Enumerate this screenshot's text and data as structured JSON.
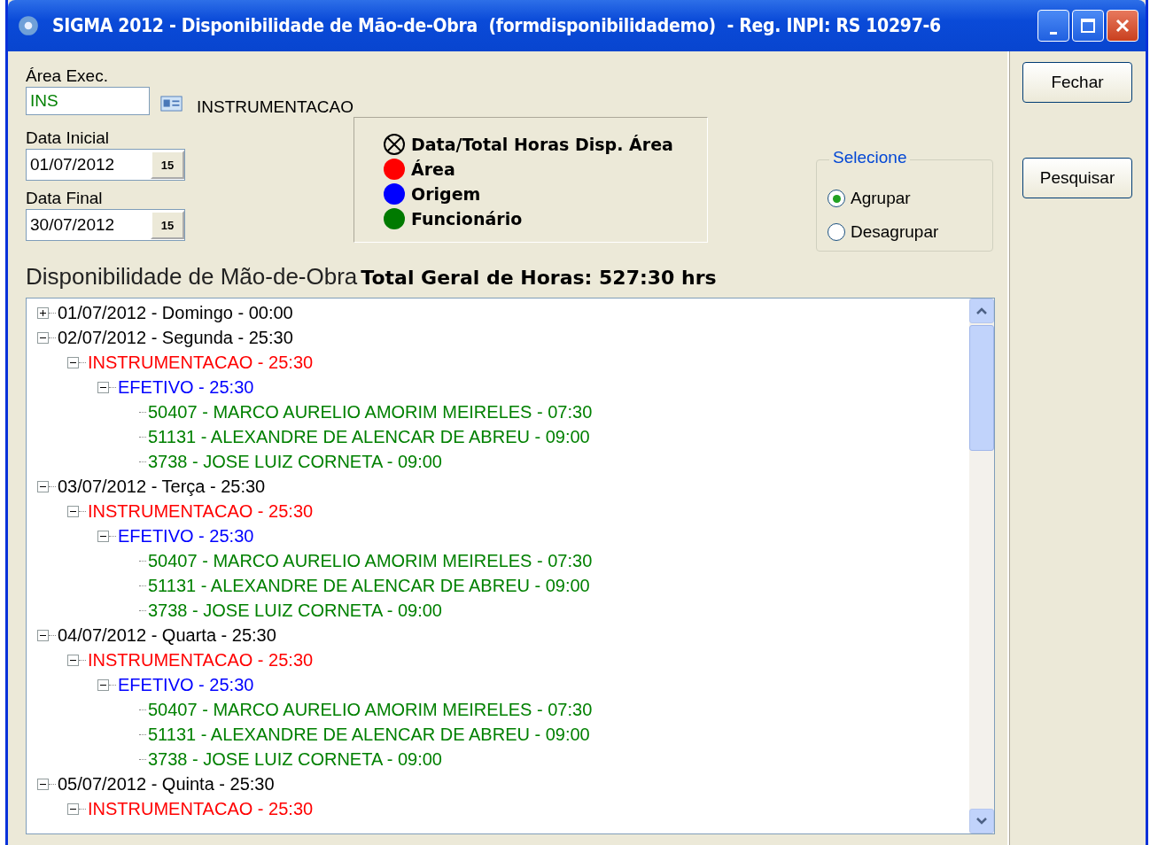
{
  "window": {
    "title": "SIGMA 2012 - Disponibilidade de Mão-de-Obra  (formdisponibilidademo)  - Reg. INPI: RS 10297-6"
  },
  "area_exec": {
    "label": "Área Exec.",
    "value": "INS",
    "description": "INSTRUMENTACAO"
  },
  "data_inicial": {
    "label": "Data Inicial",
    "value": "01/07/2012",
    "button": "15"
  },
  "data_final": {
    "label": "Data Final",
    "value": "30/07/2012",
    "button": "15"
  },
  "legend": [
    {
      "kind": "cross",
      "label": "Data/Total Horas Disp. Área"
    },
    {
      "kind": "dot",
      "color": "#ff0000",
      "label": "Área"
    },
    {
      "kind": "dot",
      "color": "#0000ff",
      "label": "Origem"
    },
    {
      "kind": "dot",
      "color": "#007a00",
      "label": "Funcionário"
    }
  ],
  "selecione": {
    "title": "Selecione",
    "options": [
      {
        "label": "Agrupar",
        "selected": true
      },
      {
        "label": "Desagrupar",
        "selected": false
      }
    ]
  },
  "section_title": "Disponibilidade de Mão-de-Obra",
  "total": "Total Geral de Horas: 527:30 hrs",
  "tree": [
    {
      "kind": "date",
      "label": "01/07/2012 - Domingo - 00:00",
      "expanded": false
    },
    {
      "kind": "date",
      "label": "02/07/2012 - Segunda - 25:30",
      "expanded": true,
      "children": [
        {
          "kind": "area",
          "label": "INSTRUMENTACAO - 25:30",
          "expanded": true,
          "children": [
            {
              "kind": "origem",
              "label": "EFETIVO - 25:30",
              "expanded": true,
              "children": [
                {
                  "kind": "funcionario",
                  "label": "50407 - MARCO AURELIO AMORIM MEIRELES - 07:30"
                },
                {
                  "kind": "funcionario",
                  "label": "51131 - ALEXANDRE DE ALENCAR DE ABREU - 09:00"
                },
                {
                  "kind": "funcionario",
                  "label": "3738 - JOSE LUIZ CORNETA - 09:00"
                }
              ]
            }
          ]
        }
      ]
    },
    {
      "kind": "date",
      "label": "03/07/2012 - Terça - 25:30",
      "expanded": true,
      "children": [
        {
          "kind": "area",
          "label": "INSTRUMENTACAO - 25:30",
          "expanded": true,
          "children": [
            {
              "kind": "origem",
              "label": "EFETIVO - 25:30",
              "expanded": true,
              "children": [
                {
                  "kind": "funcionario",
                  "label": "50407 - MARCO AURELIO AMORIM MEIRELES - 07:30"
                },
                {
                  "kind": "funcionario",
                  "label": "51131 - ALEXANDRE DE ALENCAR DE ABREU - 09:00"
                },
                {
                  "kind": "funcionario",
                  "label": "3738 - JOSE LUIZ CORNETA - 09:00"
                }
              ]
            }
          ]
        }
      ]
    },
    {
      "kind": "date",
      "label": "04/07/2012 - Quarta - 25:30",
      "expanded": true,
      "children": [
        {
          "kind": "area",
          "label": "INSTRUMENTACAO - 25:30",
          "expanded": true,
          "children": [
            {
              "kind": "origem",
              "label": "EFETIVO - 25:30",
              "expanded": true,
              "children": [
                {
                  "kind": "funcionario",
                  "label": "50407 - MARCO AURELIO AMORIM MEIRELES - 07:30"
                },
                {
                  "kind": "funcionario",
                  "label": "51131 - ALEXANDRE DE ALENCAR DE ABREU - 09:00"
                },
                {
                  "kind": "funcionario",
                  "label": "3738 - JOSE LUIZ CORNETA - 09:00"
                }
              ]
            }
          ]
        }
      ]
    },
    {
      "kind": "date",
      "label": "05/07/2012 - Quinta - 25:30",
      "expanded": true,
      "children": [
        {
          "kind": "area",
          "label": "INSTRUMENTACAO - 25:30",
          "expanded": true
        }
      ]
    }
  ],
  "buttons": {
    "close": "Fechar",
    "search": "Pesquisar"
  }
}
